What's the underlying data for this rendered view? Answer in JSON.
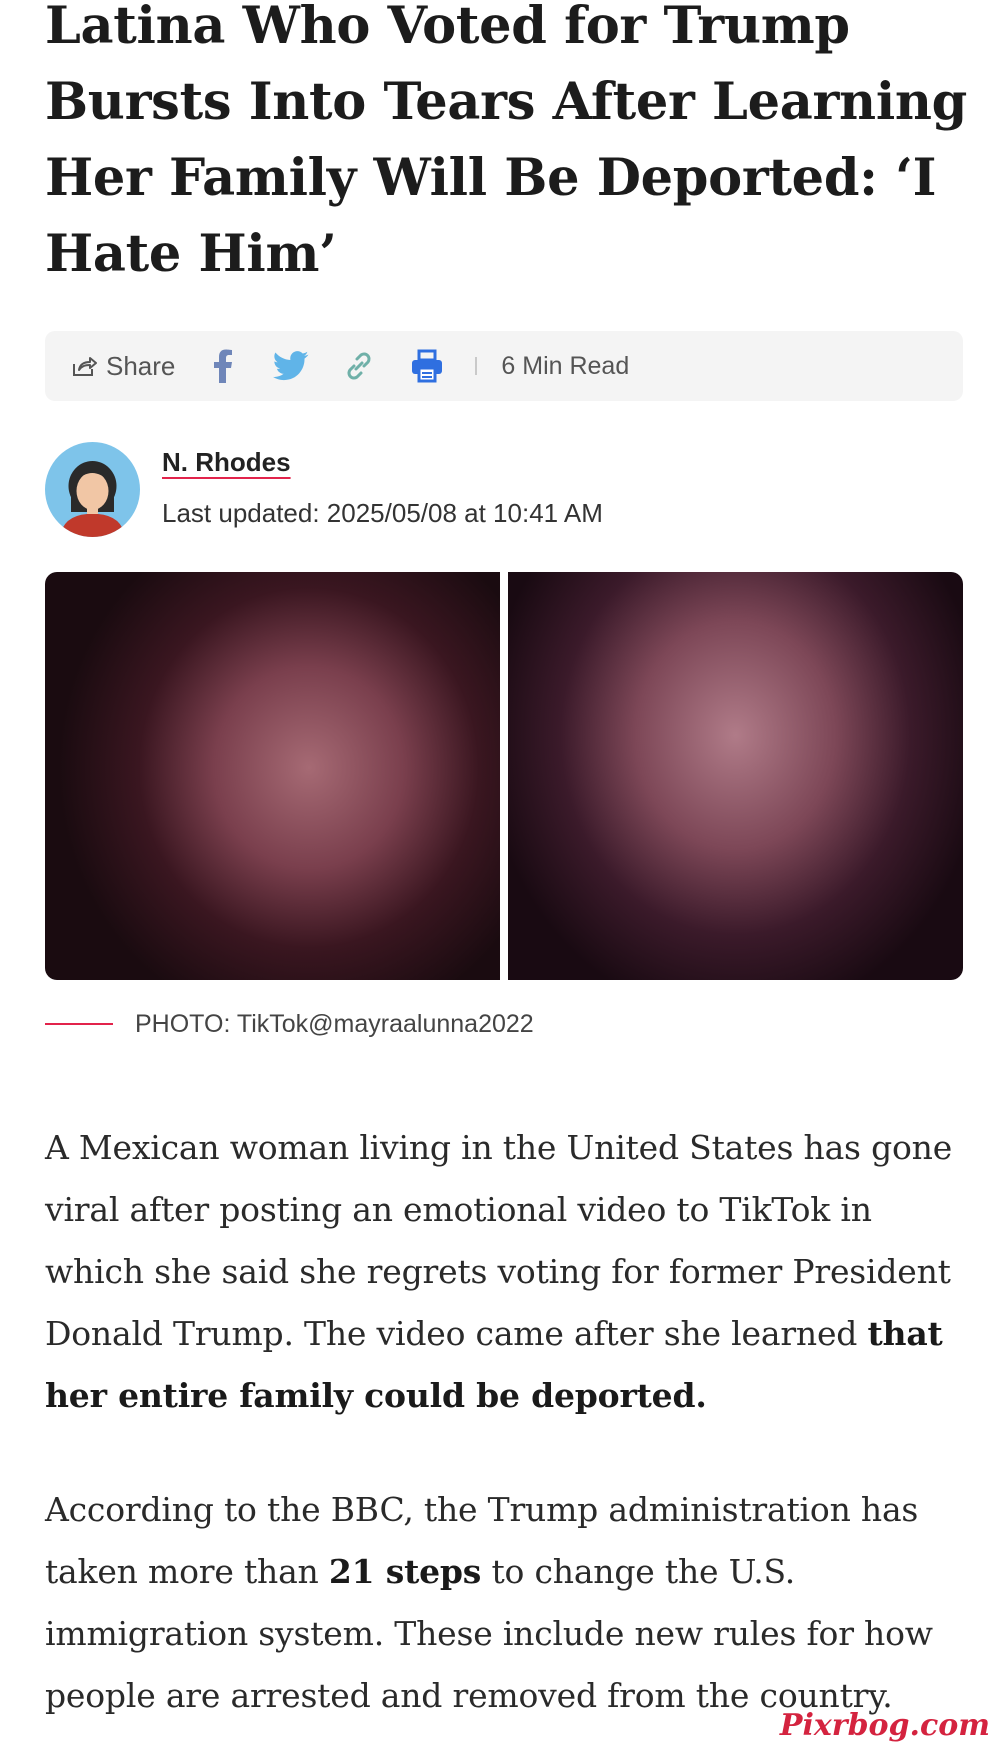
{
  "article": {
    "title": "Latina Who Voted for Trump Bursts Into Tears After Learning Her Family Will Be Deported: ‘I Hate Him’"
  },
  "share_bar": {
    "share_label": "Share",
    "icons": [
      "share-icon",
      "facebook-icon",
      "twitter-icon",
      "copy-link-icon",
      "print-icon"
    ],
    "read_time": "6 Min Read"
  },
  "author": {
    "name": "N. Rhodes",
    "updated": "Last updated: 2025/05/08 at 10:41 AM"
  },
  "photo": {
    "caption": "PHOTO: TikTok@mayraalunna2022"
  },
  "body": {
    "p1_text": "A Mexican woman living in the United States has gone viral after posting an emotional video to TikTok in which she said she regrets voting for former President Donald Trump. The video came after she learned ",
    "p1_bold": "that her entire family could be deported.",
    "p2_before": "According to the BBC, the Trump administration has taken more than ",
    "p2_bold": "21 steps",
    "p2_after": " to change the U.S. immigration system. These include new rules for how people are arrested and removed from the country."
  },
  "watermark": "Pixrbog.com",
  "colors": {
    "accent": "#e2234b",
    "facebook": "#3b5998",
    "twitter": "#1da1f2",
    "print": "#2f6fe0"
  }
}
